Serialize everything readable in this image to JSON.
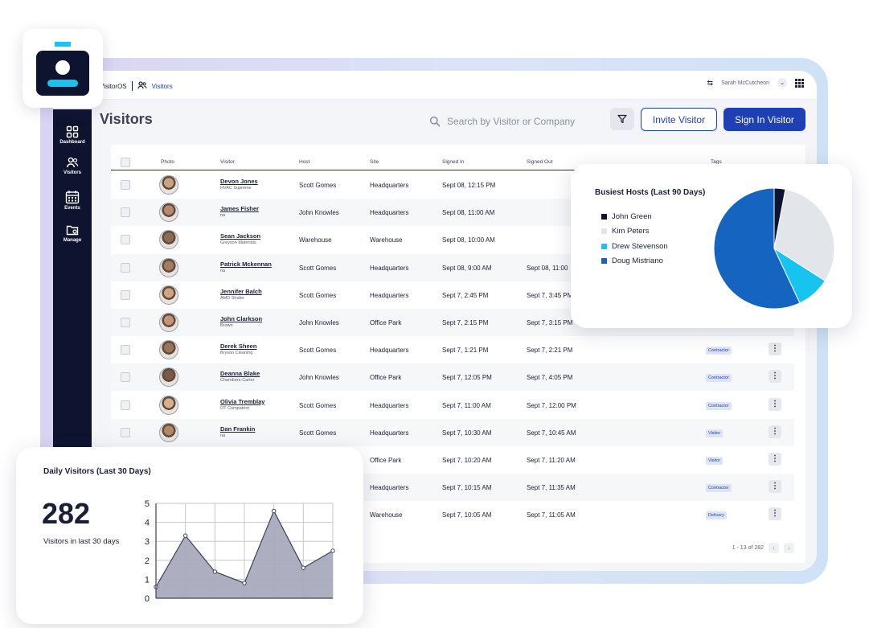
{
  "topbar": {
    "app_name": "VisitorOS",
    "section": "Visitors",
    "user": "Sarah McCutcheon"
  },
  "sidebar": {
    "items": [
      {
        "label": "Dashboard",
        "icon": "dashboard-icon"
      },
      {
        "label": "Visitors",
        "icon": "users-icon"
      },
      {
        "label": "Events",
        "icon": "calendar-icon"
      },
      {
        "label": "Manage",
        "icon": "folder-gear-icon"
      }
    ]
  },
  "page": {
    "title": "Visitors",
    "search_placeholder": "Search by Visitor or Company",
    "invite_label": "Invite Visitor",
    "signin_label": "Sign In Visitor"
  },
  "table": {
    "headers": [
      "Photo",
      "Visitor",
      "Host",
      "Site",
      "Signed In",
      "Signed Out",
      "Tags"
    ],
    "rows": [
      {
        "name": "Devon Jones",
        "company": "HVAC Supreme",
        "host": "Scott Gomes",
        "site": "Headquarters",
        "signed_in": "Sept 08, 12:15 PM",
        "signed_out": "",
        "tag": ""
      },
      {
        "name": "James Fisher",
        "company": "na",
        "host": "John Knowles",
        "site": "Headquarters",
        "signed_in": "Sept 08, 11:00 AM",
        "signed_out": "",
        "tag": ""
      },
      {
        "name": "Sean Jackson",
        "company": "Greyson Materials",
        "host": "Warehouse",
        "site": "Warehouse",
        "signed_in": "Sept 08, 10:00 AM",
        "signed_out": "",
        "tag": ""
      },
      {
        "name": "Patrick Mckennan",
        "company": "na",
        "host": "Scott Gomes",
        "site": "Headquarters",
        "signed_in": "Sept 08, 9:00 AM",
        "signed_out": "Sept 08, 11:00",
        "tag": ""
      },
      {
        "name": "Jennifer Balch",
        "company": "AMD Shafer",
        "host": "Scott Gomes",
        "site": "Headquarters",
        "signed_in": "Sept 7, 2:45 PM",
        "signed_out": "Sept 7, 3:45 PM",
        "tag": ""
      },
      {
        "name": "John Clarkson",
        "company": "Brown",
        "host": "John Knowles",
        "site": "Office Park",
        "signed_in": "Sept 7, 2:15 PM",
        "signed_out": "Sept 7, 3:15 PM",
        "tag": ""
      },
      {
        "name": "Derek Sheen",
        "company": "Bryson Cleaning",
        "host": "Scott Gomes",
        "site": "Headquarters",
        "signed_in": "Sept 7, 1:21 PM",
        "signed_out": "Sept 7, 2:21 PM",
        "tag": "Contractor"
      },
      {
        "name": "Deanna Blake",
        "company": "Chambers-Carter",
        "host": "John Knowles",
        "site": "Office Park",
        "signed_in": "Sept 7, 12:05 PM",
        "signed_out": "Sept 7, 4:05 PM",
        "tag": "Contractor"
      },
      {
        "name": "Olivia Tremblay",
        "company": "OT Compatriot",
        "host": "Scott Gomes",
        "site": "Headquarters",
        "signed_in": "Sept 7, 11:00 AM",
        "signed_out": "Sept 7, 12:00 PM",
        "tag": "Contractor"
      },
      {
        "name": "Dan Frankin",
        "company": "na",
        "host": "Scott Gomes",
        "site": "Headquarters",
        "signed_in": "Sept 7, 10:30 AM",
        "signed_out": "Sept 7, 10:45 AM",
        "tag": "Visitor"
      },
      {
        "name": "",
        "company": "",
        "host": "",
        "site": "Office Park",
        "signed_in": "Sept 7, 10:20 AM",
        "signed_out": "Sept 7, 11:20 AM",
        "tag": "Visitor"
      },
      {
        "name": "",
        "company": "",
        "host": "",
        "site": "Headquarters",
        "signed_in": "Sept 7, 10:15 AM",
        "signed_out": "Sept 7, 11:35 AM",
        "tag": "Contractor"
      },
      {
        "name": "",
        "company": "",
        "host": "",
        "site": "Warehouse",
        "signed_in": "Sept 7, 10:05 AM",
        "signed_out": "Sept 7, 11:05 AM",
        "tag": "Delivery"
      }
    ],
    "pagination": "1 - 13 of 282"
  },
  "pie_card": {
    "title": "Busiest Hosts (Last 90 Days)",
    "legend": [
      {
        "name": "John Green",
        "color": "#0e1430"
      },
      {
        "name": "Kim Peters",
        "color": "#e2e5ea"
      },
      {
        "name": "Drew Stevenson",
        "color": "#17c3ef"
      },
      {
        "name": "Doug Mistriano",
        "color": "#1565c0"
      }
    ]
  },
  "line_card": {
    "title": "Daily Visitors (Last 30 Days)",
    "total": "282",
    "subtitle": "Visitors in last 30 days"
  },
  "chart_data": [
    {
      "type": "pie",
      "title": "Busiest Hosts (Last 90 Days)",
      "categories": [
        "John Green",
        "Kim Peters",
        "Drew Stevenson",
        "Doug Mistriano"
      ],
      "values": [
        3,
        31,
        9,
        57
      ],
      "colors": [
        "#0e1430",
        "#e2e5ea",
        "#17c3ef",
        "#1565c0"
      ]
    },
    {
      "type": "area",
      "title": "Daily Visitors (Last 30 Days)",
      "values": [
        0.6,
        3.3,
        1.4,
        0.8,
        4.6,
        1.6,
        2.5
      ],
      "ylim": [
        0,
        5
      ],
      "yticks": [
        0,
        1,
        2,
        3,
        4,
        5
      ],
      "grid": true,
      "color": "#a9abbd"
    }
  ]
}
